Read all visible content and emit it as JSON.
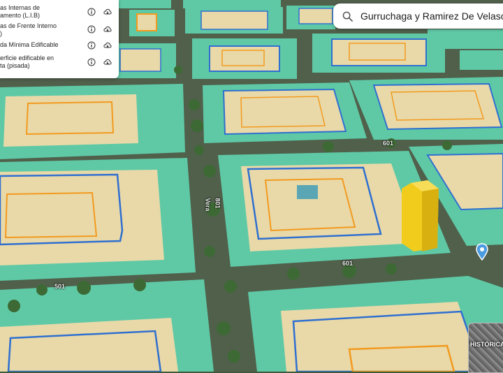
{
  "legend": {
    "items": [
      {
        "label": "as Internas de\namento (L.I.B)",
        "info_icon": "info-icon",
        "cloud_icon": "cloud-download-icon"
      },
      {
        "label": "as de Frente Interno\n)",
        "info_icon": "info-icon",
        "cloud_icon": "cloud-download-icon"
      },
      {
        "label": "da Mínima Edificable",
        "info_icon": "info-icon",
        "cloud_icon": "cloud-download-icon"
      },
      {
        "label": "erficie edificable en\nta (pisada)",
        "info_icon": "info-icon",
        "cloud_icon": "cloud-download-icon"
      }
    ]
  },
  "search": {
    "value": "Gurruchaga y Ramirez De Velasco, Ju",
    "icon": "search-icon"
  },
  "streets": {
    "vera_name": "Vera",
    "vera_number": "801",
    "label_601_top": "601",
    "label_601_mid": "601",
    "label_501": "501"
  },
  "historic": {
    "label": "HISTÓRICA"
  },
  "colors": {
    "block_green": "#5fc9a6",
    "lot_beige": "#e9d9a8",
    "lib_blue": "#2f6fd0",
    "lfi_orange": "#f29a1f",
    "building_yellow": "#f2cc1c",
    "pin_blue": "#4a9be0"
  }
}
